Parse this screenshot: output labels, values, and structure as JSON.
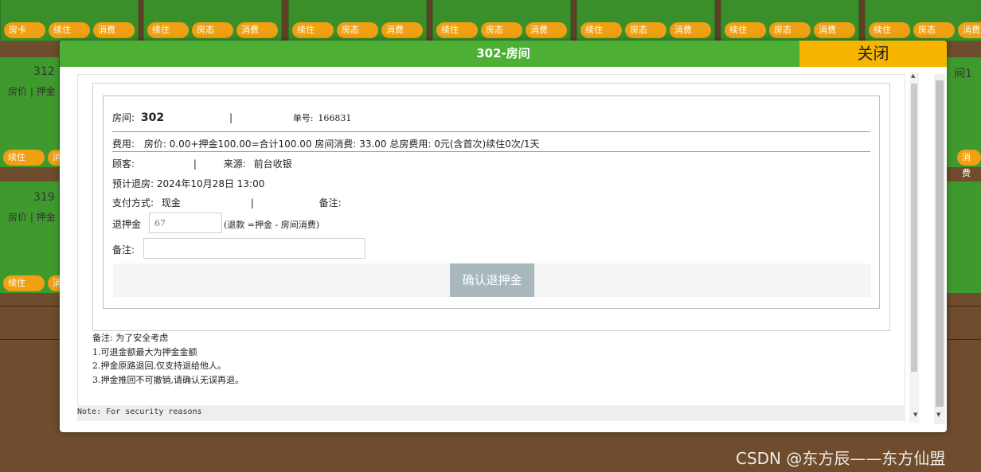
{
  "background": {
    "top_row_buttons": [
      [
        "房卡",
        "续住",
        "消费"
      ],
      [
        "续住",
        "房态",
        "消费"
      ],
      [
        "续住",
        "房态",
        "消费"
      ],
      [
        "续住",
        "房态",
        "消费"
      ],
      [
        "续住",
        "房态",
        "消费"
      ],
      [
        "续住",
        "房态",
        "消费"
      ],
      [
        "续住",
        "房态",
        "消费"
      ]
    ],
    "left_cards": [
      {
        "number": "312",
        "price": "房价 | 押金",
        "buttons": [
          "续住",
          "消费"
        ]
      },
      {
        "number": "319",
        "price": "房价 | 押金",
        "buttons": [
          "续住",
          "消费"
        ]
      }
    ],
    "right_cards": [
      {
        "number": "间1",
        "button": "消费"
      }
    ]
  },
  "modal": {
    "title": "302-房间",
    "close_label": "关闭",
    "room_label": "房间:",
    "room_value": "302",
    "divider": "|",
    "order_label": "单号:",
    "order_value": "166831",
    "fee_label": "费用:",
    "fee_text": "房价: 0.00+押金100.00=合计100.00 房间消费: 33.00 总房费用: 0元(含首次)续住0次/1天",
    "guest_label": "顾客:",
    "source_label": "来源:",
    "source_value": "前台收银",
    "checkout_label": "预计退房:",
    "checkout_value": "2024年10月28日 13:00",
    "payment_label": "支付方式:",
    "payment_value": "现金",
    "payment_remark_label": "备注:",
    "refund_label": "退押金",
    "refund_placeholder": "67",
    "refund_formula": "(退款   =押金  -  房间消费)",
    "remark_label": "备注:",
    "remark_value": "",
    "confirm_label": "确认退押金",
    "notes": [
      "备注: 为了安全考虑",
      "1.可退金额最大为押金金额",
      "2.押金原路退回,仅支持退给他人。",
      "3.押金推回不可撤销,请确认无误再退。"
    ],
    "footer_note": "Note: For security reasons"
  },
  "watermark": "CSDN @东方辰——东方仙盟",
  "colors": {
    "header_green": "#4db035",
    "close_amber": "#f7b500",
    "room_card_green": "#3f9a2e",
    "button_orange": "#f0a012",
    "confirm_btn": "#a9b8bd",
    "background_brown": "#6e4c2d"
  }
}
